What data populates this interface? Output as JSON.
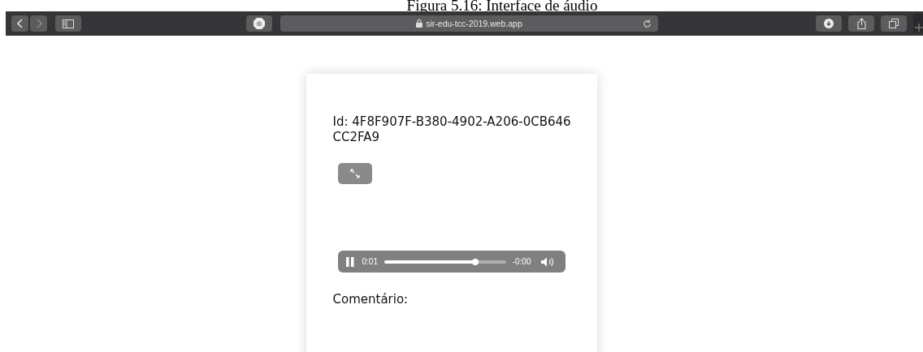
{
  "caption": "Figura 5.16: Interface de áudio",
  "browser": {
    "url": "sir-edu-tcc-2019.web.app"
  },
  "card": {
    "id_label": "Id: 4F8F907F-B380-4902-A206-0CB646CC2FA9",
    "player": {
      "playing": true,
      "elapsed": "0:01",
      "remaining": "-0:00",
      "level": 0.75
    },
    "comment_label": "Comentário:"
  }
}
